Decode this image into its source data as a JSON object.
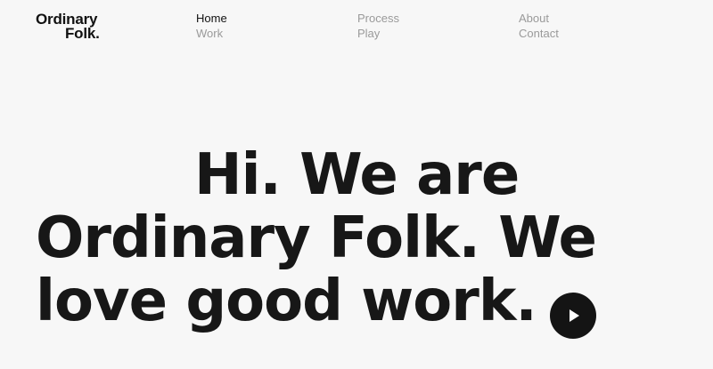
{
  "logo": {
    "line1": "Ordinary",
    "line2": "Folk."
  },
  "nav": {
    "columns": [
      [
        {
          "label": "Home",
          "active": true
        },
        {
          "label": "Work",
          "active": false
        }
      ],
      [
        {
          "label": "Process",
          "active": false
        },
        {
          "label": "Play",
          "active": false
        }
      ],
      [
        {
          "label": "About",
          "active": false
        },
        {
          "label": "Contact",
          "active": false
        }
      ]
    ]
  },
  "hero": {
    "line1": "Hi. We are",
    "line2": "Ordinary Folk. We",
    "line3": "love good work."
  },
  "play_button": {
    "icon": "play-icon"
  },
  "colors": {
    "background": "#f7f7f7",
    "text": "#171717",
    "nav_muted": "#9a9a9a",
    "button": "#141414"
  }
}
